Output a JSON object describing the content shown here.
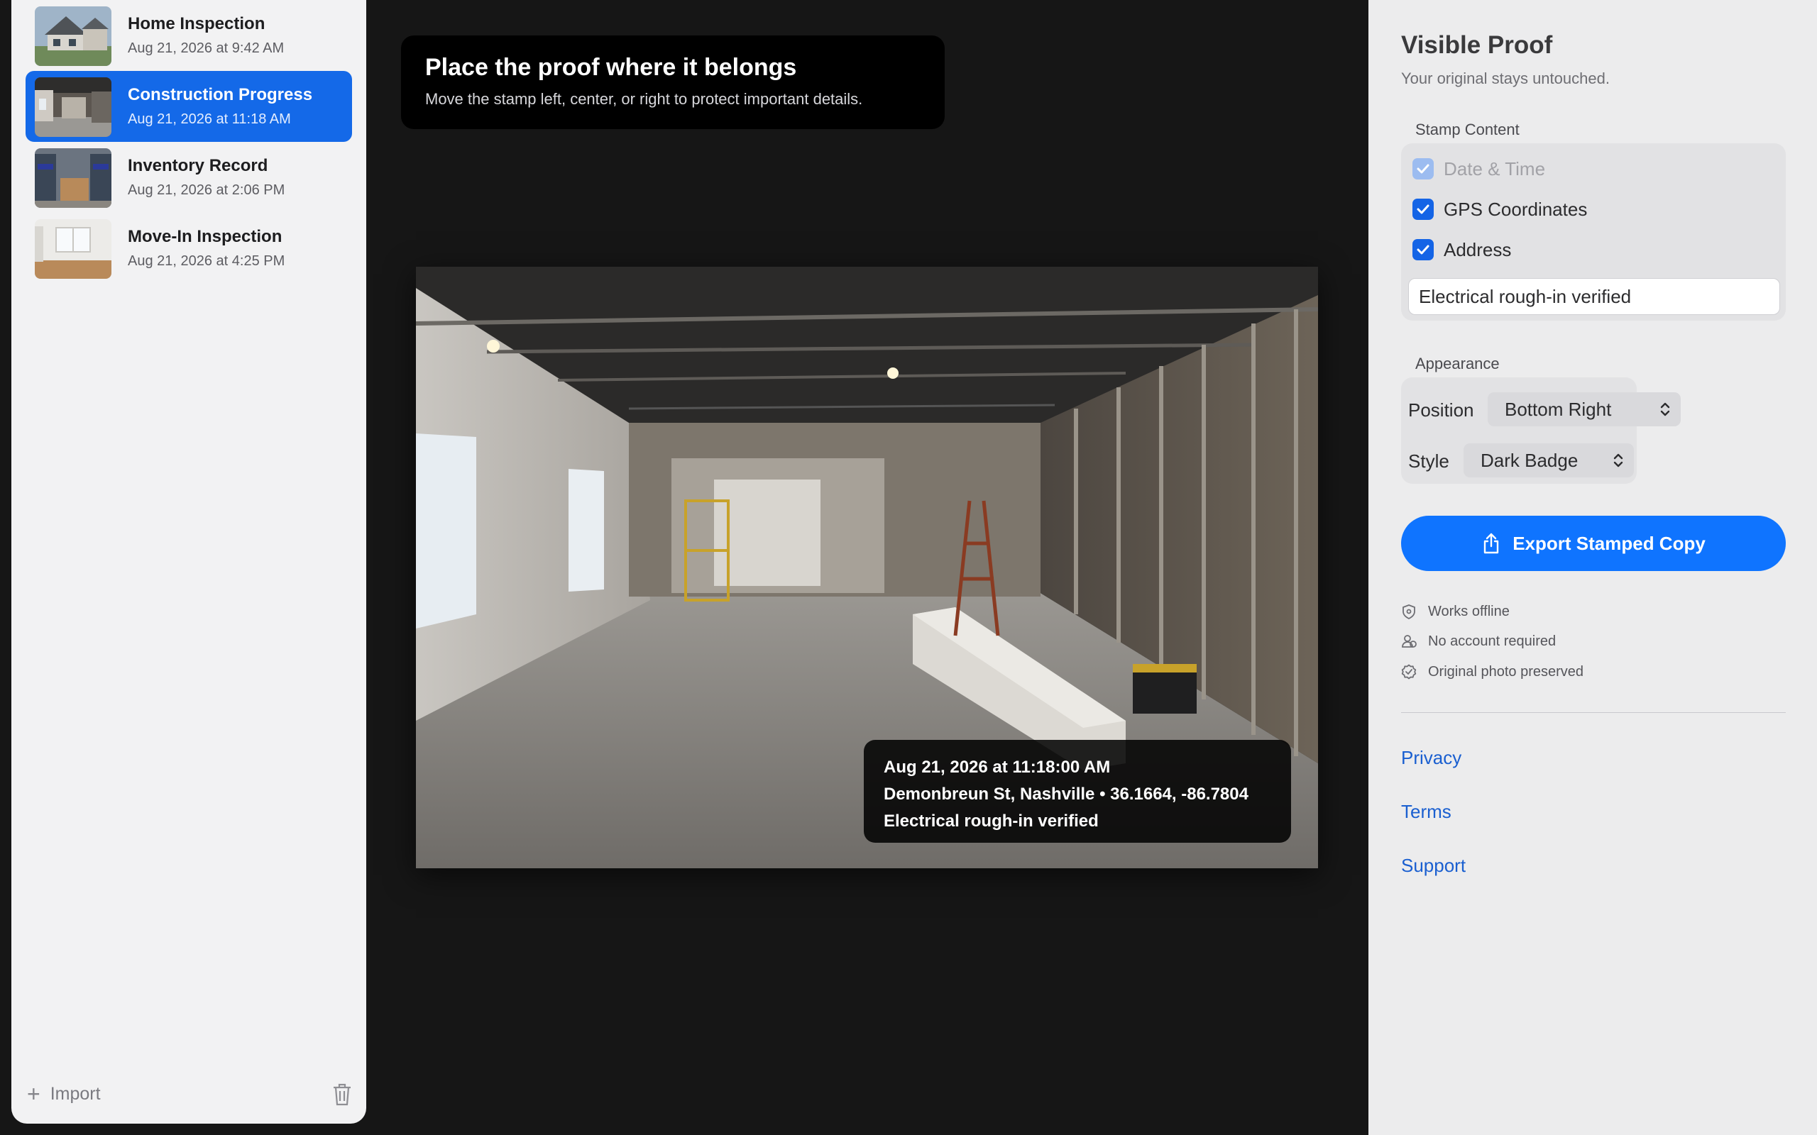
{
  "sidebar": {
    "items": [
      {
        "title": "Home Inspection",
        "date": "Aug 21, 2026 at 9:42 AM"
      },
      {
        "title": "Construction Progress",
        "date": "Aug 21, 2026 at 11:18 AM",
        "selected": true
      },
      {
        "title": "Inventory Record",
        "date": "Aug 21, 2026 at 2:06 PM"
      },
      {
        "title": "Move-In Inspection",
        "date": "Aug 21, 2026 at 4:25 PM"
      }
    ],
    "import_label": "Import",
    "trash_icon": "trash-icon"
  },
  "banner": {
    "title": "Place the proof where it belongs",
    "subtitle": "Move the stamp left, center, or right to protect important details."
  },
  "stamp": {
    "line1": "Aug 21, 2026 at 11:18:00 AM",
    "line2": "Demonbreun St, Nashville • 36.1664, -86.7804",
    "line3": "Electrical rough-in verified"
  },
  "panel": {
    "title": "Visible Proof",
    "subtitle": "Your original stays untouched.",
    "stamp_content": {
      "label": "Stamp Content",
      "options": [
        {
          "label": "Date & Time",
          "checked": true,
          "disabled": true
        },
        {
          "label": "GPS Coordinates",
          "checked": true,
          "disabled": false
        },
        {
          "label": "Address",
          "checked": true,
          "disabled": false
        }
      ],
      "note_value": "Electrical rough-in verified"
    },
    "appearance": {
      "label": "Appearance",
      "position_label": "Position",
      "position_value": "Bottom Right",
      "style_label": "Style",
      "style_value": "Dark Badge"
    },
    "export_label": "Export Stamped Copy",
    "features": [
      {
        "icon": "shield-icon",
        "label": "Works offline"
      },
      {
        "icon": "person-icon",
        "label": "No account required"
      },
      {
        "icon": "check-seal-icon",
        "label": "Original photo preserved"
      }
    ],
    "links": [
      "Privacy",
      "Terms",
      "Support"
    ]
  },
  "colors": {
    "accent": "#0f74ff",
    "selected": "#1469e8",
    "link": "#1a5fd0",
    "canvas_bg": "#161616"
  }
}
